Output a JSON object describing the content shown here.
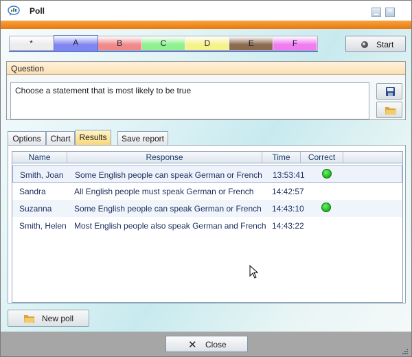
{
  "window": {
    "title": "Poll"
  },
  "choices": [
    "*",
    "A",
    "B",
    "C",
    "D",
    "E",
    "F"
  ],
  "choice_colors": [
    "#ececec",
    "#7f86f0",
    "#f08a8a",
    "#8ef08e",
    "#f5f28a",
    "#8b6a4e",
    "#f07cf0"
  ],
  "selected_choice": "A",
  "start_button": {
    "label": "Start"
  },
  "question": {
    "header": "Question",
    "text": "Choose a statement that is most likely to be true"
  },
  "tabs": [
    "Options",
    "Chart",
    "Results",
    "Save report"
  ],
  "active_tab": "Results",
  "results": {
    "columns": [
      "Name",
      "Response",
      "Time",
      "Correct"
    ],
    "rows": [
      {
        "name": "Smith, Joan",
        "response": "Some English people can speak German or French",
        "time": "13:53:41",
        "correct": true
      },
      {
        "name": "Sandra",
        "response": "All English people must speak German or French",
        "time": "14:42:57",
        "correct": false
      },
      {
        "name": "Suzanna",
        "response": "Some English people can speak German or French",
        "time": "14:43:10",
        "correct": true
      },
      {
        "name": "Smith, Helen",
        "response": "Most English people also speak German and French",
        "time": "14:43:22",
        "correct": false
      }
    ]
  },
  "new_poll_button": {
    "label": "New poll"
  },
  "close_button": {
    "label": "Close"
  }
}
